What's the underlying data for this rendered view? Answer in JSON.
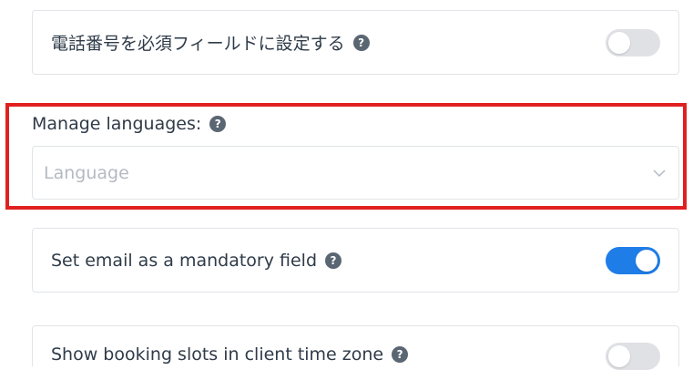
{
  "settings": {
    "phone_required": {
      "label": "電話番号を必須フィールドに設定する",
      "help_glyph": "?",
      "enabled": false
    },
    "manage_languages": {
      "label": "Manage languages:",
      "help_glyph": "?",
      "placeholder": "Language"
    },
    "email_required": {
      "label": "Set email as a mandatory field",
      "help_glyph": "?",
      "enabled": true
    },
    "client_timezone": {
      "label": "Show booking slots in client time zone",
      "help_glyph": "?",
      "enabled": false
    }
  },
  "colors": {
    "highlight": "#e02020",
    "toggle_on": "#1f7de8",
    "toggle_off": "#dfe1e5"
  }
}
